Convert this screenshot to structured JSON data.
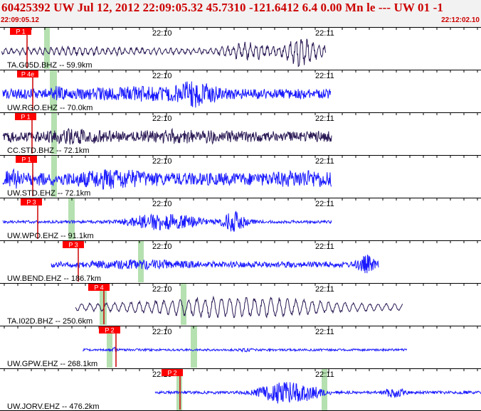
{
  "header": {
    "title": "60425392 UW Jul 12, 2012 22:09:05.32   45.7310 -121.6412  6.4 0.00 Mn le --- UW 01  -1",
    "start_time": "22:09:05.12",
    "end_time": "22:12:02.10"
  },
  "colors": {
    "trace_dark": "#2b1a55",
    "trace_blue": "#1a1aff",
    "pick_red": "#ff0000",
    "green_band": "#b5e0b0",
    "header_text": "#cc0000"
  },
  "time_ticks": [
    "22:10",
    "22:11"
  ],
  "channels": [
    {
      "label": "TA.G05D.BHZ -- 59.9km",
      "pick": "P 1",
      "color": "dark"
    },
    {
      "label": "UW.RGO.EHZ -- 70.0km",
      "pick": "P 4e",
      "color": "blue"
    },
    {
      "label": "CC.STD.BHZ -- 72.1km",
      "pick": "P 1",
      "color": "dark"
    },
    {
      "label": "UW.STD.EHZ -- 72.1km",
      "pick": "P 1",
      "color": "blue"
    },
    {
      "label": "UW.WPO.EHZ -- 91.1km",
      "pick": "P 3",
      "color": "blue"
    },
    {
      "label": "UW.BEND.EHZ -- 186.7km",
      "pick": "P 3",
      "color": "blue"
    },
    {
      "label": "TA.I02D.BHZ -- 250.6km",
      "pick": "P 4",
      "color": "dark"
    },
    {
      "label": "UW.GPW.EHZ -- 268.1km",
      "pick": "P 2",
      "color": "blue"
    },
    {
      "label": "UW.JORV.EHZ -- 476.2km",
      "pick": "P 2",
      "color": "blue"
    }
  ]
}
